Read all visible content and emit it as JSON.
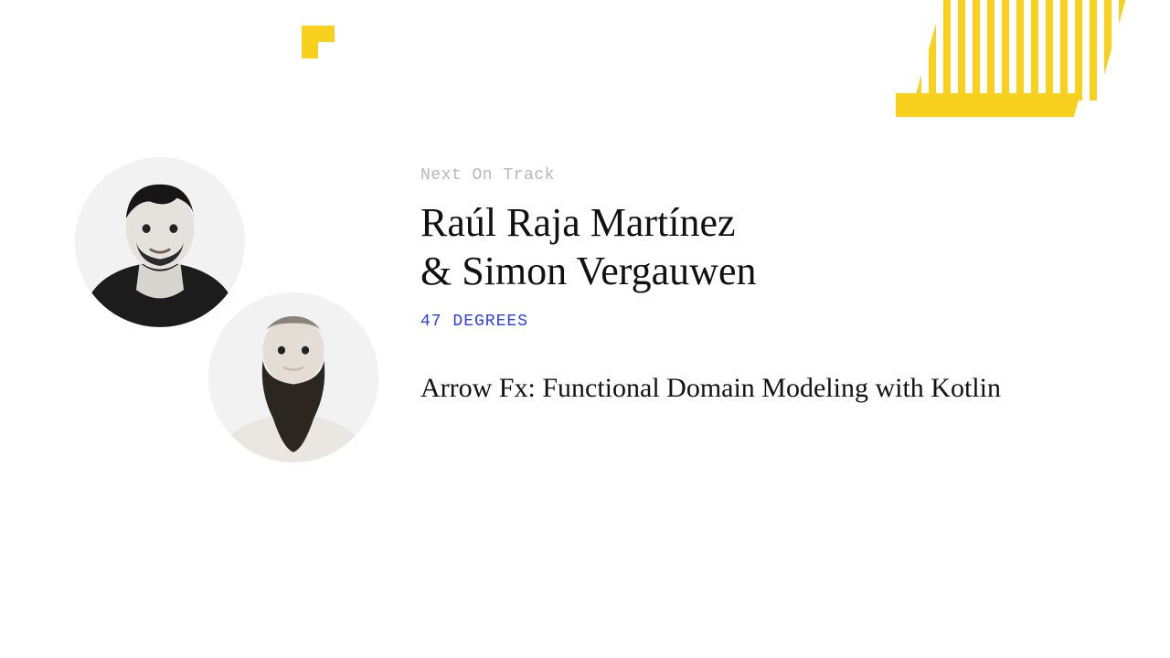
{
  "eyebrow": "Next On Track",
  "speaker_line_1": "Raúl Raja Martínez",
  "speaker_line_2": "& Simon Vergauwen",
  "company": "47 DEGREES",
  "talk_title": "Arrow Fx: Functional Domain Modeling with Kotlin",
  "colors": {
    "accent_yellow": "#F7D11E",
    "accent_blue": "#2A3FE6",
    "eyebrow_gray": "#B8B8B8"
  }
}
